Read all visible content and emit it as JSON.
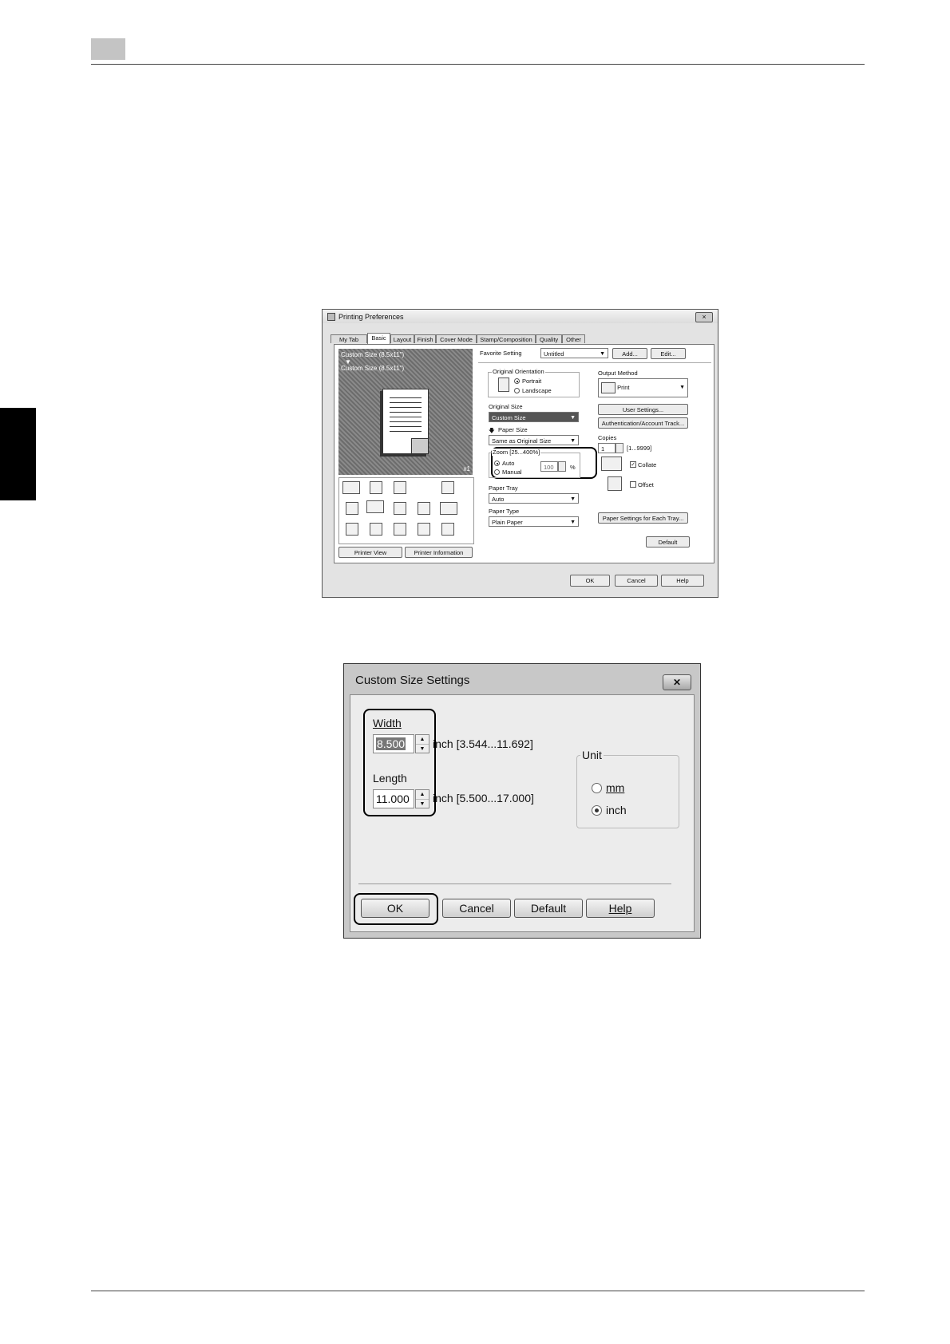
{
  "dialog1": {
    "title": "Printing Preferences",
    "close": "×",
    "tabs": [
      "My Tab",
      "Basic",
      "Layout",
      "Finish",
      "Cover Mode",
      "Stamp/Composition",
      "Quality",
      "Other"
    ],
    "preview": {
      "line1": "Custom Size (8.5x11\")",
      "arrow": "▼",
      "line2": "Custom Size (8.5x11\")",
      "count": "x1"
    },
    "printer_view": "Printer View",
    "printer_information": "Printer Information",
    "favorite_label": "Favorite Setting",
    "favorite_value": "Untitled",
    "add": "Add...",
    "edit": "Edit...",
    "orientation_label": "Original Orientation",
    "portrait": "Portrait",
    "landscape": "Landscape",
    "original_size_label": "Original Size",
    "original_size_value": "Custom Size",
    "paper_size_label": "Paper Size",
    "paper_size_value": "Same as Original Size",
    "zoom_label": "Zoom [25...400%]",
    "zoom_auto": "Auto",
    "zoom_manual": "Manual",
    "zoom_value": "100",
    "zoom_unit": "%",
    "paper_tray_label": "Paper Tray",
    "paper_tray_value": "Auto",
    "paper_type_label": "Paper Type",
    "paper_type_value": "Plain Paper",
    "output_method_label": "Output Method",
    "output_method_value": "Print",
    "user_settings": "User Settings...",
    "auth": "Authentication/Account Track...",
    "copies_label": "Copies",
    "copies_value": "1",
    "copies_range": "[1...9999]",
    "collate": "Collate",
    "offset": "Offset",
    "paper_settings": "Paper Settings for Each Tray...",
    "default": "Default",
    "ok": "OK",
    "cancel": "Cancel",
    "help": "Help"
  },
  "dialog2": {
    "title": "Custom Size Settings",
    "close": "✕",
    "width_label": "Width",
    "width_value": "8.500",
    "width_range": "inch [3.544...11.692]",
    "length_label": "Length",
    "length_value": "11.000",
    "length_range": "inch [5.500...17.000]",
    "unit_label": "Unit",
    "unit_mm": "mm",
    "unit_inch": "inch",
    "ok": "OK",
    "cancel": "Cancel",
    "default": "Default",
    "help": "Help"
  }
}
